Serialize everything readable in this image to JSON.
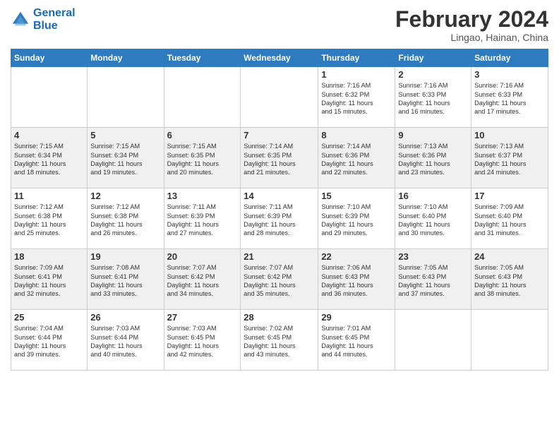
{
  "header": {
    "logo_line1": "General",
    "logo_line2": "Blue",
    "month_title": "February 2024",
    "subtitle": "Lingao, Hainan, China"
  },
  "weekdays": [
    "Sunday",
    "Monday",
    "Tuesday",
    "Wednesday",
    "Thursday",
    "Friday",
    "Saturday"
  ],
  "weeks": [
    [
      {
        "day": "",
        "info": ""
      },
      {
        "day": "",
        "info": ""
      },
      {
        "day": "",
        "info": ""
      },
      {
        "day": "",
        "info": ""
      },
      {
        "day": "1",
        "info": "Sunrise: 7:16 AM\nSunset: 6:32 PM\nDaylight: 11 hours\nand 15 minutes."
      },
      {
        "day": "2",
        "info": "Sunrise: 7:16 AM\nSunset: 6:33 PM\nDaylight: 11 hours\nand 16 minutes."
      },
      {
        "day": "3",
        "info": "Sunrise: 7:16 AM\nSunset: 6:33 PM\nDaylight: 11 hours\nand 17 minutes."
      }
    ],
    [
      {
        "day": "4",
        "info": "Sunrise: 7:15 AM\nSunset: 6:34 PM\nDaylight: 11 hours\nand 18 minutes."
      },
      {
        "day": "5",
        "info": "Sunrise: 7:15 AM\nSunset: 6:34 PM\nDaylight: 11 hours\nand 19 minutes."
      },
      {
        "day": "6",
        "info": "Sunrise: 7:15 AM\nSunset: 6:35 PM\nDaylight: 11 hours\nand 20 minutes."
      },
      {
        "day": "7",
        "info": "Sunrise: 7:14 AM\nSunset: 6:35 PM\nDaylight: 11 hours\nand 21 minutes."
      },
      {
        "day": "8",
        "info": "Sunrise: 7:14 AM\nSunset: 6:36 PM\nDaylight: 11 hours\nand 22 minutes."
      },
      {
        "day": "9",
        "info": "Sunrise: 7:13 AM\nSunset: 6:36 PM\nDaylight: 11 hours\nand 23 minutes."
      },
      {
        "day": "10",
        "info": "Sunrise: 7:13 AM\nSunset: 6:37 PM\nDaylight: 11 hours\nand 24 minutes."
      }
    ],
    [
      {
        "day": "11",
        "info": "Sunrise: 7:12 AM\nSunset: 6:38 PM\nDaylight: 11 hours\nand 25 minutes."
      },
      {
        "day": "12",
        "info": "Sunrise: 7:12 AM\nSunset: 6:38 PM\nDaylight: 11 hours\nand 26 minutes."
      },
      {
        "day": "13",
        "info": "Sunrise: 7:11 AM\nSunset: 6:39 PM\nDaylight: 11 hours\nand 27 minutes."
      },
      {
        "day": "14",
        "info": "Sunrise: 7:11 AM\nSunset: 6:39 PM\nDaylight: 11 hours\nand 28 minutes."
      },
      {
        "day": "15",
        "info": "Sunrise: 7:10 AM\nSunset: 6:39 PM\nDaylight: 11 hours\nand 29 minutes."
      },
      {
        "day": "16",
        "info": "Sunrise: 7:10 AM\nSunset: 6:40 PM\nDaylight: 11 hours\nand 30 minutes."
      },
      {
        "day": "17",
        "info": "Sunrise: 7:09 AM\nSunset: 6:40 PM\nDaylight: 11 hours\nand 31 minutes."
      }
    ],
    [
      {
        "day": "18",
        "info": "Sunrise: 7:09 AM\nSunset: 6:41 PM\nDaylight: 11 hours\nand 32 minutes."
      },
      {
        "day": "19",
        "info": "Sunrise: 7:08 AM\nSunset: 6:41 PM\nDaylight: 11 hours\nand 33 minutes."
      },
      {
        "day": "20",
        "info": "Sunrise: 7:07 AM\nSunset: 6:42 PM\nDaylight: 11 hours\nand 34 minutes."
      },
      {
        "day": "21",
        "info": "Sunrise: 7:07 AM\nSunset: 6:42 PM\nDaylight: 11 hours\nand 35 minutes."
      },
      {
        "day": "22",
        "info": "Sunrise: 7:06 AM\nSunset: 6:43 PM\nDaylight: 11 hours\nand 36 minutes."
      },
      {
        "day": "23",
        "info": "Sunrise: 7:05 AM\nSunset: 6:43 PM\nDaylight: 11 hours\nand 37 minutes."
      },
      {
        "day": "24",
        "info": "Sunrise: 7:05 AM\nSunset: 6:43 PM\nDaylight: 11 hours\nand 38 minutes."
      }
    ],
    [
      {
        "day": "25",
        "info": "Sunrise: 7:04 AM\nSunset: 6:44 PM\nDaylight: 11 hours\nand 39 minutes."
      },
      {
        "day": "26",
        "info": "Sunrise: 7:03 AM\nSunset: 6:44 PM\nDaylight: 11 hours\nand 40 minutes."
      },
      {
        "day": "27",
        "info": "Sunrise: 7:03 AM\nSunset: 6:45 PM\nDaylight: 11 hours\nand 42 minutes."
      },
      {
        "day": "28",
        "info": "Sunrise: 7:02 AM\nSunset: 6:45 PM\nDaylight: 11 hours\nand 43 minutes."
      },
      {
        "day": "29",
        "info": "Sunrise: 7:01 AM\nSunset: 6:45 PM\nDaylight: 11 hours\nand 44 minutes."
      },
      {
        "day": "",
        "info": ""
      },
      {
        "day": "",
        "info": ""
      }
    ]
  ]
}
